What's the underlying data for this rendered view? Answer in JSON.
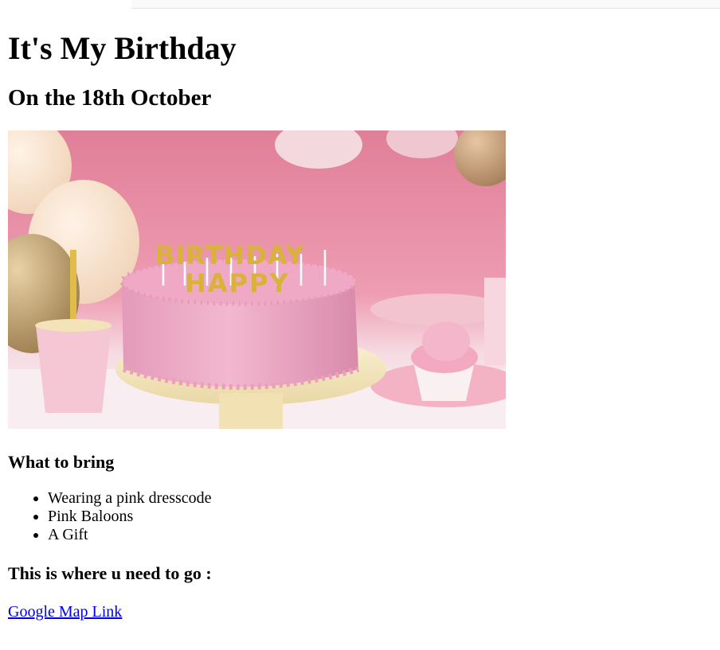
{
  "page": {
    "title": "It's My Birthday",
    "subtitle": "On the 18th October",
    "image_alt": "Pink birthday cake with HAPPY BIRTHDAY candles",
    "bring_heading": "What to bring",
    "bring_items": [
      "Wearing a pink dresscode",
      "Pink Baloons",
      "A Gift"
    ],
    "where_heading": "This is where u need to go :",
    "map_link_label": "Google Map Link"
  },
  "colors": {
    "link": "#0000ee",
    "backdrop_pink": "#e88ea6",
    "cake_pink": "#eea7c2",
    "candle_gold": "#d9b23a"
  }
}
